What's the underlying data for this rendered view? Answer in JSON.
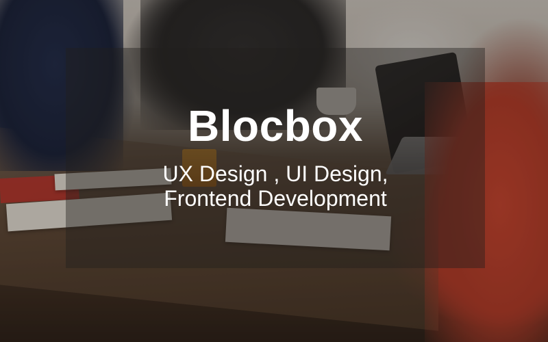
{
  "hero": {
    "title": "Blocbox",
    "subtitle_line1": "UX Design , UI Design,",
    "subtitle_line2": "Frontend Development"
  },
  "colors": {
    "text": "#ffffff",
    "overlay": "rgba(34,30,28,0.42)",
    "accent_red": "#c4332a"
  }
}
